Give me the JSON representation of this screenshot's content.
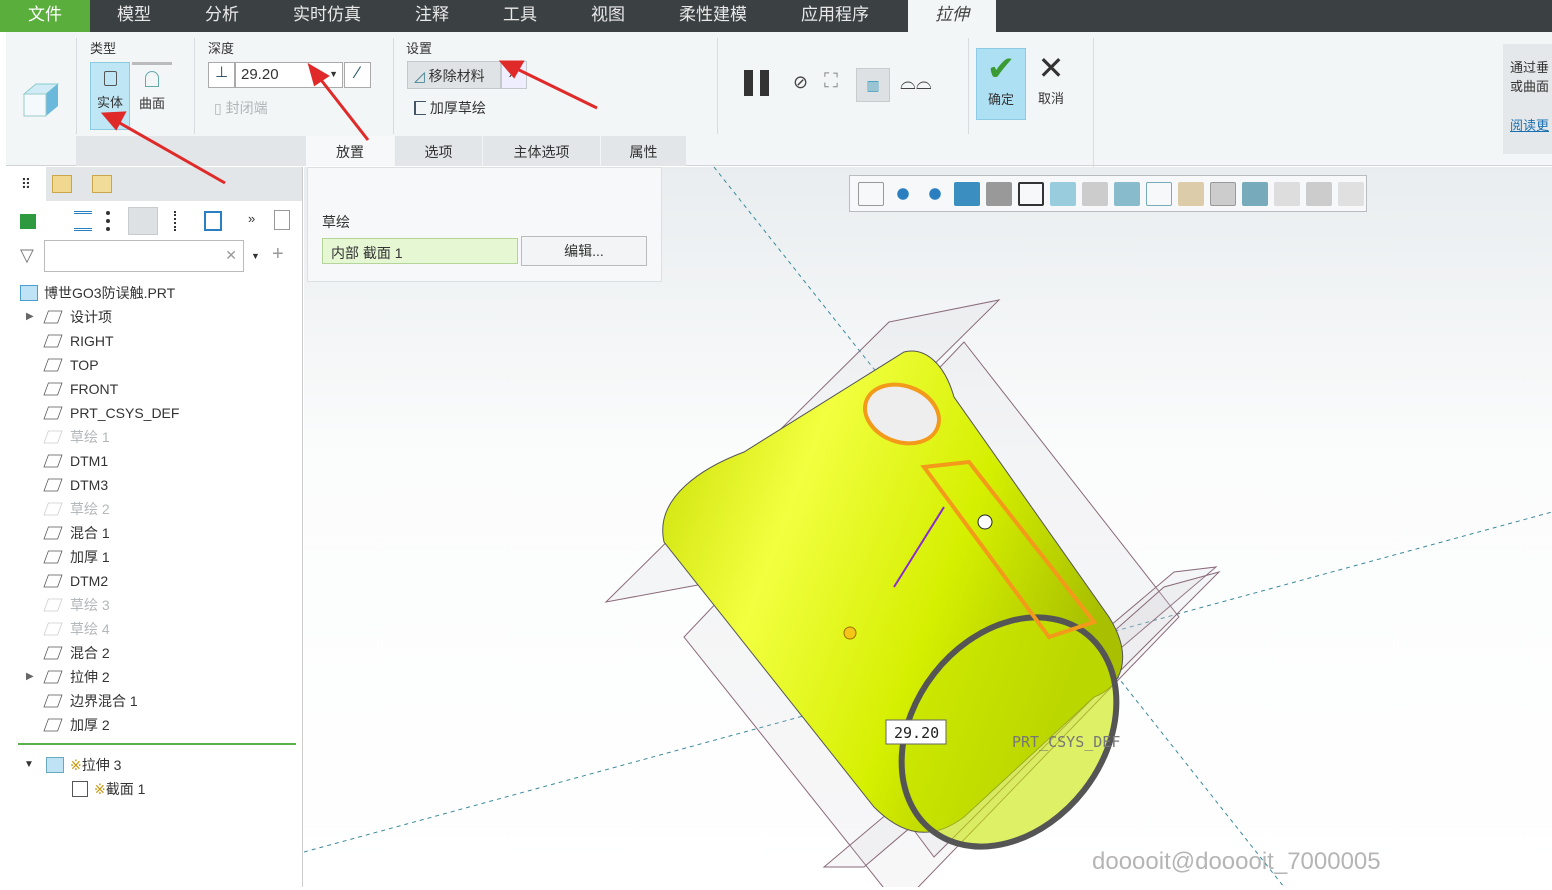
{
  "menubar": {
    "items": [
      "文件",
      "模型",
      "分析",
      "实时仿真",
      "注释",
      "工具",
      "视图",
      "柔性建模",
      "应用程序"
    ],
    "active_tab": "拉伸"
  },
  "ribbon": {
    "type": {
      "label": "类型",
      "solid": "实体",
      "surface": "曲面"
    },
    "depth": {
      "label": "深度",
      "value": "29.20",
      "capped_ends": "封闭端"
    },
    "settings": {
      "label": "设置",
      "remove_material": "移除材料",
      "thicken_sketch": "加厚草绘"
    },
    "ok": "确定",
    "cancel": "取消",
    "help": {
      "line1": "通过垂",
      "line2": "或曲面",
      "link": "阅读更"
    },
    "subtabs": [
      "放置",
      "选项",
      "主体选项",
      "属性"
    ]
  },
  "placement_panel": {
    "sketch_label": "草绘",
    "sketch_value": "内部 截面 1",
    "edit_button": "编辑..."
  },
  "tree": {
    "root": "博世GO3防误触.PRT",
    "items": [
      {
        "label": "设计项",
        "dim": false,
        "expand": true
      },
      {
        "label": "RIGHT",
        "dim": false
      },
      {
        "label": "TOP",
        "dim": false
      },
      {
        "label": "FRONT",
        "dim": false
      },
      {
        "label": "PRT_CSYS_DEF",
        "dim": false
      },
      {
        "label": "草绘 1",
        "dim": true
      },
      {
        "label": "DTM1",
        "dim": false
      },
      {
        "label": "DTM3",
        "dim": false
      },
      {
        "label": "草绘 2",
        "dim": true
      },
      {
        "label": "混合 1",
        "dim": false
      },
      {
        "label": "加厚 1",
        "dim": false
      },
      {
        "label": "DTM2",
        "dim": false
      },
      {
        "label": "草绘 3",
        "dim": true
      },
      {
        "label": "草绘 4",
        "dim": true
      },
      {
        "label": "混合 2",
        "dim": false
      },
      {
        "label": "拉伸 2",
        "dim": false,
        "expand": true
      },
      {
        "label": "边界混合 1",
        "dim": false
      },
      {
        "label": "加厚 2",
        "dim": false
      }
    ],
    "current": "拉伸 3",
    "child": "截面 1",
    "new_marker": "※"
  },
  "viewport": {
    "dimension": "29.20",
    "csys_label": "PRT_CSYS_DEF",
    "watermark": "dooooit@dooooit_7000005"
  },
  "colors": {
    "menubar": "#3b4143",
    "file_tab": "#5aae3c",
    "model": "#d8f000",
    "accent": "#bfe6f5"
  }
}
